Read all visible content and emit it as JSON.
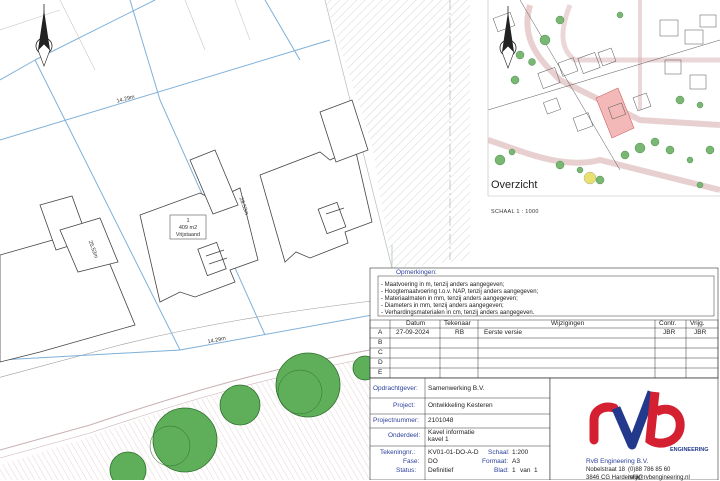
{
  "plot": {
    "dimensions": [
      "14.29m",
      "25.53m",
      "28.53m",
      "14.29m"
    ],
    "lot_number": "1",
    "lot_area": "409 m2",
    "lot_status": "Vrijstaand"
  },
  "overview": {
    "title": "Overzicht",
    "scale": "SCHAAL 1 : 1000"
  },
  "notes": {
    "heading": "Opmerkingen:",
    "items": [
      "- Maatvoering in m, tenzij anders aangegeven;",
      "- Hoogtemaatvoering t.o.v. NAP, tenzij anders aangegeven;",
      "- Materiaalmaten in mm, tenzij anders aangegeven;",
      "- Diameters in mm, tenzij anders aangegeven;",
      "- Verhardingsmaterialen in cm, tenzij anders aangegeven."
    ]
  },
  "revisions": {
    "headers": [
      "Datum",
      "Tekenaar",
      "Wijzigingen",
      "Contr.",
      "Vrijg."
    ],
    "rows": [
      {
        "letter": "A",
        "datum": "27-09-2024",
        "tekenaar": "RB",
        "wijziging": "Eerste versie",
        "contr": "JBR",
        "vrijg": "JBR"
      },
      {
        "letter": "B",
        "datum": "",
        "tekenaar": "",
        "wijziging": "",
        "contr": "",
        "vrijg": ""
      },
      {
        "letter": "C",
        "datum": "",
        "tekenaar": "",
        "wijziging": "",
        "contr": "",
        "vrijg": ""
      },
      {
        "letter": "D",
        "datum": "",
        "tekenaar": "",
        "wijziging": "",
        "contr": "",
        "vrijg": ""
      },
      {
        "letter": "E",
        "datum": "",
        "tekenaar": "",
        "wijziging": "",
        "contr": "",
        "vrijg": ""
      }
    ]
  },
  "titleblock": {
    "opdrachtgever_label": "Opdrachtgever:",
    "opdrachtgever": "Samenwerking B.V.",
    "project_label": "Project:",
    "project": "Ontwikkeling Kesteren",
    "projectnummer_label": "Projectnummer:",
    "projectnummer": "2101048",
    "onderdeel_label": "Onderdeel:",
    "onderdeel_1": "Kavel informatie",
    "onderdeel_2": "kavel 1",
    "tekening_label": "Tekeningnr.:",
    "tekening": "KV01-01-DO-A-D",
    "fase_label": "Fase:",
    "fase": "DO",
    "status_label": "Status:",
    "status": "Definitief",
    "schaal_label": "Schaal:",
    "schaal": "1:200",
    "formaat_label": "Formaat:",
    "formaat": "A3",
    "blad_label": "Blad:",
    "blad_1": "1",
    "blad_van": "van",
    "blad_2": "1"
  },
  "company": {
    "name": "RvB Engineering B.V.",
    "street": "Nobelstraat 18",
    "city": "3846 CG Harderwijk",
    "phone": "(0)88 786 85 60",
    "email": "info@rvbengineering.nl",
    "logo_text": "ENGINEERING"
  },
  "colors": {
    "label_blue": "#2a3f9a",
    "logo_red": "#d42030",
    "logo_blue": "#233a8c",
    "highlight_lot": "#f3b9b9"
  }
}
